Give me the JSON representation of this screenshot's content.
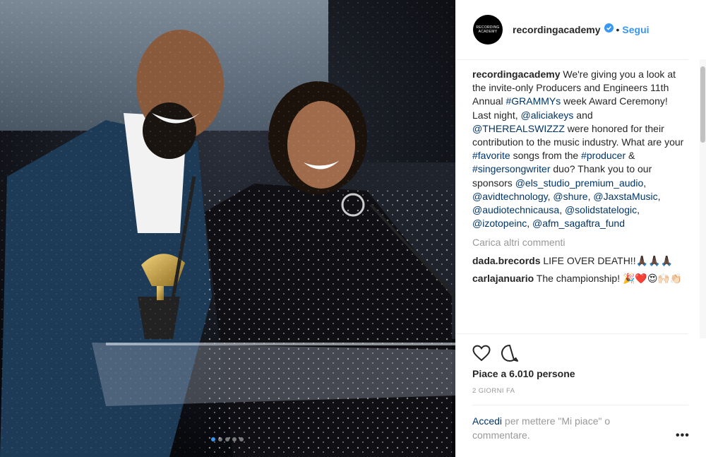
{
  "account": {
    "username": "recordingacademy",
    "avatar_text": "RECORDING ACADEMY",
    "verified_icon": "verified-badge-icon",
    "separator": "•",
    "follow_label": "Segui"
  },
  "caption": {
    "username": "recordingacademy",
    "text_1": " We're giving you a look at the invite-only Producers and Engineers 11th Annual ",
    "tag_1": "#GRAMMYs",
    "text_2": " week Award Ceremony! Last night, ",
    "tag_2": "@aliciakeys",
    "text_3": " and ",
    "tag_3": "@THEREALSWIZZZ",
    "text_4": " were honored for their contribution to the music industry. What are your ",
    "tag_4": "#favorite",
    "text_5": " songs from the ",
    "tag_5": "#producer",
    "text_6": " & ",
    "tag_6": "#singersongwriter",
    "text_7": " duo? Thank you to our sponsors ",
    "tag_7": "@els_studio_premium_audio",
    "text_8": ", ",
    "tag_8": "@avidtechnology",
    "text_9": ", ",
    "tag_9": "@shure",
    "text_10": ", ",
    "tag_10": "@JaxstaMusic",
    "text_11": ", ",
    "tag_11": "@audiotechnicausa",
    "text_12": ", ",
    "tag_12": "@solidstatelogic",
    "text_13": ", ",
    "tag_13": "@izotopeinc",
    "text_14": ", ",
    "tag_14": "@afm_sagaftra_fund"
  },
  "load_more_label": "Carica altri commenti",
  "comments": [
    {
      "username": "dada.brecords",
      "text": "LIFE OVER DEATH!!🙏🏿🙏🏿🙏🏿"
    },
    {
      "username": "carlajanuario",
      "text": "The championship! 🎉❤️😍🙌🏻👏🏻"
    }
  ],
  "actions": {
    "like_icon": "heart-icon",
    "comment_icon": "comment-icon",
    "likes_text": "Piace a 6.010 persone",
    "timestamp": "2 GIORNI FA"
  },
  "login": {
    "link": "Accedi",
    "text": " per mettere \"Mi piace\" o commentare."
  },
  "more_label": "•••",
  "carousel": {
    "count": 5,
    "active": 1
  },
  "colors": {
    "link": "#3897f0",
    "tag": "#003569",
    "muted": "#999999"
  }
}
